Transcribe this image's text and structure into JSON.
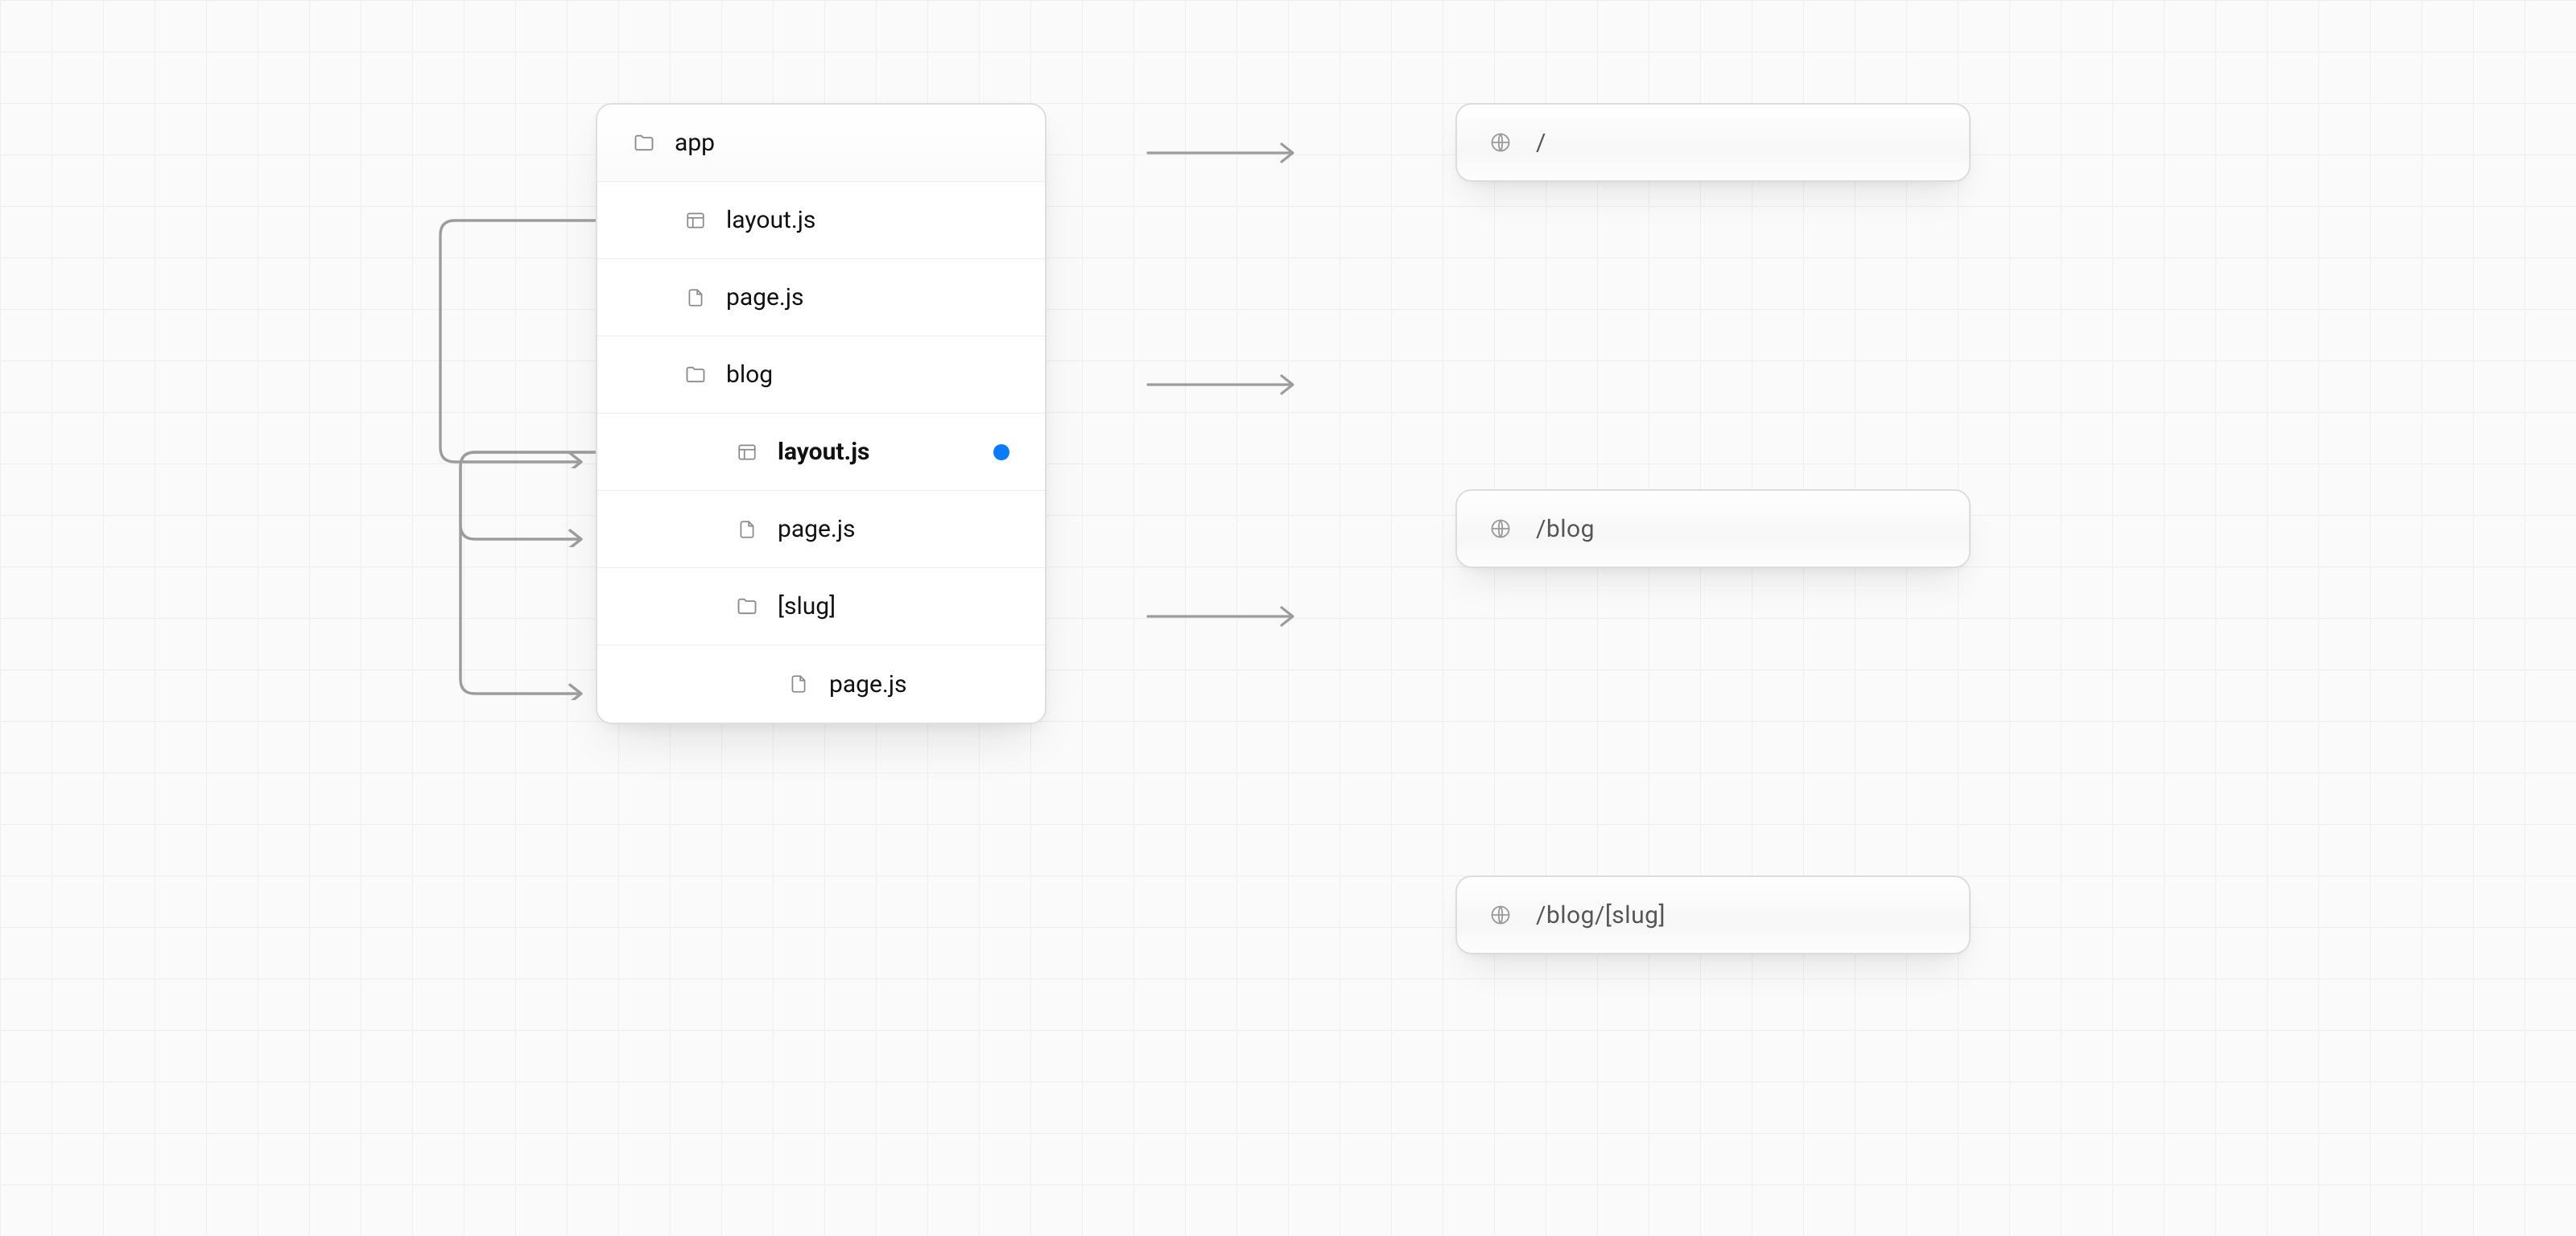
{
  "tree": {
    "root": "app",
    "rows": [
      {
        "icon": "folder",
        "label": "app",
        "indent": 0
      },
      {
        "icon": "layout",
        "label": "layout.js",
        "indent": 1
      },
      {
        "icon": "file",
        "label": "page.js",
        "indent": 1
      },
      {
        "icon": "folder",
        "label": "blog",
        "indent": 1
      },
      {
        "icon": "layout",
        "label": "layout.js",
        "indent": 2,
        "bold": true,
        "dot": true
      },
      {
        "icon": "file",
        "label": "page.js",
        "indent": 2
      },
      {
        "icon": "folder",
        "label": "[slug]",
        "indent": 2
      },
      {
        "icon": "file",
        "label": "page.js",
        "indent": 3
      }
    ]
  },
  "urls": [
    {
      "path": "/"
    },
    {
      "path": "/blog"
    },
    {
      "path": "/blog/[slug]"
    }
  ],
  "colors": {
    "dot": "#0a7aff",
    "arrow": "#9c9c9c"
  }
}
